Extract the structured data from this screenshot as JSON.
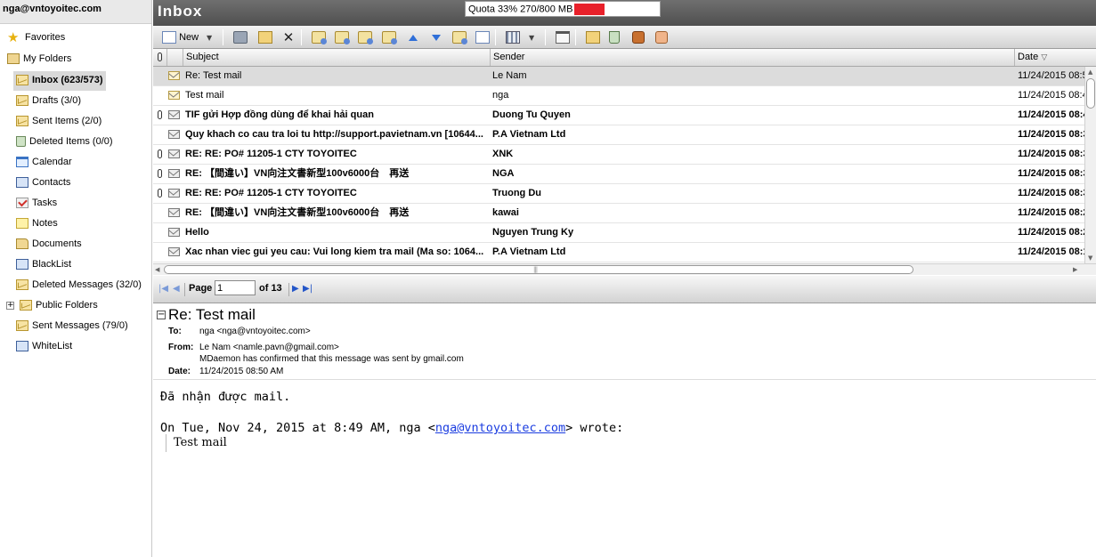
{
  "account": "nga@vntoyoitec.com",
  "folders": [
    {
      "label": "Favorites",
      "icon": "star-icon"
    },
    {
      "label": "My Folders",
      "icon": "folders-icon"
    },
    {
      "label": "Inbox (623/573)",
      "icon": "mail-icon"
    },
    {
      "label": "Drafts (3/0)",
      "icon": "mail-icon"
    },
    {
      "label": "Sent Items (2/0)",
      "icon": "mail-icon"
    },
    {
      "label": "Deleted Items (0/0)",
      "icon": "trash-icon"
    },
    {
      "label": "Calendar",
      "icon": "calendar-icon"
    },
    {
      "label": "Contacts",
      "icon": "contacts-book-icon"
    },
    {
      "label": "Tasks",
      "icon": "tasks-icon"
    },
    {
      "label": "Notes",
      "icon": "notes-icon"
    },
    {
      "label": "Documents",
      "icon": "documents-icon"
    },
    {
      "label": "BlackList",
      "icon": "book-icon"
    },
    {
      "label": "Deleted Messages (32/0)",
      "icon": "mail-icon"
    },
    {
      "label": "Public Folders",
      "icon": "mail-icon"
    },
    {
      "label": "Sent Messages (79/0)",
      "icon": "mail-icon"
    },
    {
      "label": "WhiteList",
      "icon": "book-icon"
    }
  ],
  "header": {
    "title": "Inbox",
    "quota_label": "Quota 33% 270/800 MB",
    "quota_fill": 0.33,
    "quota_color": "#e8202a"
  },
  "toolbar": {
    "new_label": "New"
  },
  "columns": {
    "subject": "Subject",
    "sender": "Sender",
    "date": "Date"
  },
  "messages": [
    {
      "attachment": false,
      "read": true,
      "subject": "Re: Test mail",
      "sender": "Le Nam",
      "date": "11/24/2015 08:5"
    },
    {
      "attachment": false,
      "read": true,
      "subject": "Test mail",
      "sender": "nga",
      "date": "11/24/2015 08:4"
    },
    {
      "attachment": true,
      "read": false,
      "subject": "TIF gửi Hợp đồng dùng để khai hải quan",
      "sender": "Duong Tu Quyen",
      "date": "11/24/2015 08:4"
    },
    {
      "attachment": false,
      "read": false,
      "subject": "Quy khach co cau tra loi tu http://support.pavietnam.vn [10644...",
      "sender": "P.A Vietnam Ltd",
      "date": "11/24/2015 08:3"
    },
    {
      "attachment": true,
      "read": false,
      "subject": "RE: RE: PO# 11205-1 CTY TOYOITEC",
      "sender": "XNK",
      "date": "11/24/2015 08:3"
    },
    {
      "attachment": true,
      "read": false,
      "subject": "RE: 【間違い】VN向注文書新型100v6000台　再送",
      "sender": "NGA",
      "date": "11/24/2015 08:3"
    },
    {
      "attachment": true,
      "read": false,
      "subject": "RE: RE: PO# 11205-1 CTY TOYOITEC",
      "sender": "Truong Du",
      "date": "11/24/2015 08:3"
    },
    {
      "attachment": false,
      "read": false,
      "subject": "RE: 【間違い】VN向注文書新型100v6000台　再送",
      "sender": "kawai",
      "date": "11/24/2015 08:2"
    },
    {
      "attachment": false,
      "read": false,
      "subject": "Hello",
      "sender": "Nguyen Trung Ky",
      "date": "11/24/2015 08:2"
    },
    {
      "attachment": false,
      "read": false,
      "subject": "Xac nhan viec gui yeu cau: Vui long kiem tra mail (Ma so: 1064...",
      "sender": "P.A Vietnam Ltd",
      "date": "11/24/2015 08:1"
    }
  ],
  "pager": {
    "page_label": "Page",
    "current": "1",
    "of_label": "of 13"
  },
  "preview": {
    "subject": "Re: Test mail",
    "to_label": "To:",
    "to": "nga <nga@vntoyoitec.com>",
    "from_label": "From:",
    "from": "Le Nam <namle.pavn@gmail.com>",
    "mdaemon_note": "MDaemon has confirmed that this message was sent by gmail.com",
    "date_label": "Date:",
    "date": "11/24/2015 08:50 AM",
    "body_line1": "Đã nhận được mail.",
    "body_line2_prefix": "On Tue, Nov 24, 2015 at 8:49 AM, nga <",
    "body_link": "nga@vntoyoitec.com",
    "body_line2_suffix": "> wrote:",
    "quote": "Test mail"
  }
}
